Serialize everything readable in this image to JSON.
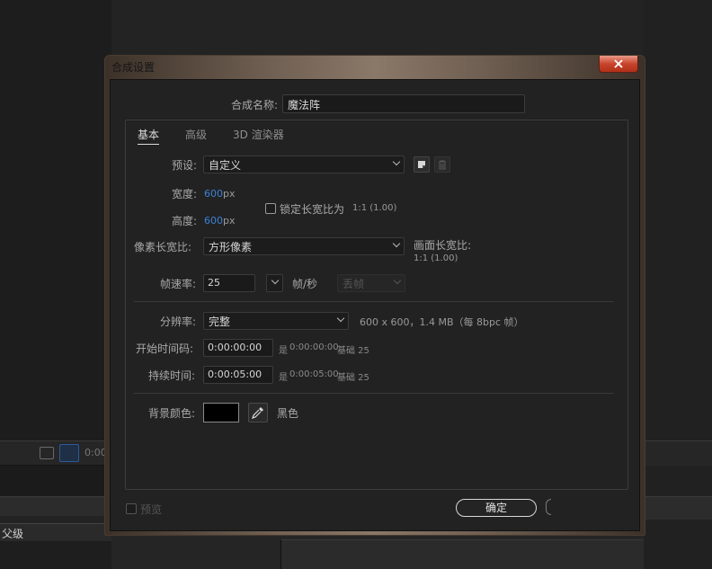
{
  "background": {
    "timecode_fragment": "0:00",
    "layer_label": "父级"
  },
  "dialog": {
    "title": "合成设置",
    "comp_name": {
      "label": "合成名称:",
      "value": "魔法阵"
    },
    "tabs": [
      {
        "label": "基本",
        "active": true
      },
      {
        "label": "高级",
        "active": false
      },
      {
        "label": "3D 渲染器",
        "active": false
      }
    ],
    "preset": {
      "label": "预设:",
      "value": "自定义"
    },
    "width": {
      "label": "宽度:",
      "value": "600",
      "unit": "px"
    },
    "height": {
      "label": "高度:",
      "value": "600",
      "unit": "px"
    },
    "lock_aspect": {
      "label": "锁定长宽比为",
      "ratio": "1:1 (1.00)",
      "checked": false
    },
    "pixel_aspect": {
      "label": "像素长宽比:",
      "value": "方形像素"
    },
    "frame_aspect": {
      "label": "画面长宽比:",
      "value": "1:1 (1.00)"
    },
    "frame_rate": {
      "label": "帧速率:",
      "value": "25",
      "unit": "帧/秒",
      "drop_frame": "丢帧"
    },
    "resolution": {
      "label": "分辨率:",
      "value": "完整",
      "info": "600 x 600，1.4 MB（每 8bpc 帧）"
    },
    "start_timecode": {
      "label": "开始时间码:",
      "value": "0:00:00:00",
      "info_prefix": "是",
      "info_value": "0:00:00:00",
      "base": "基础 25"
    },
    "duration": {
      "label": "持续时间:",
      "value": "0:00:05:00",
      "info_prefix": "是",
      "info_value": "0:00:05:00",
      "base": "基础 25"
    },
    "bg_color": {
      "label": "背景颜色:",
      "color": "#000000",
      "name": "黑色"
    },
    "preview": {
      "label": "预览",
      "checked": false
    },
    "ok_label": "确定"
  }
}
